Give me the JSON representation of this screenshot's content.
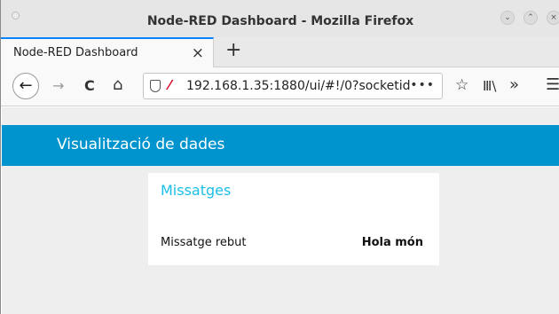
{
  "window": {
    "title": "Node-RED Dashboard - Mozilla Firefox",
    "buttons": {
      "minimize": "⌄",
      "maximize": "⌃",
      "close": "×"
    }
  },
  "tabs": [
    {
      "label": "Node-RED Dashboard",
      "close": "×",
      "active": true
    }
  ],
  "new_tab": "+",
  "navbar": {
    "back": "←",
    "forward": "→",
    "reload": "C",
    "home": "⌂",
    "url": "192.168.1.35:1880/ui/#!/0?socketid=",
    "url_more": "•••",
    "bookmark": "☆",
    "library": "Ⅲ\\",
    "overflow": "»",
    "menu": "☰"
  },
  "dashboard": {
    "title": "Visualització de dades",
    "accent": "#0094ce",
    "group_title_color": "#1bbfe5",
    "groups": [
      {
        "title": "Missatges",
        "rows": [
          {
            "label": "Missatge rebut",
            "value": "Hola món"
          }
        ]
      }
    ]
  }
}
